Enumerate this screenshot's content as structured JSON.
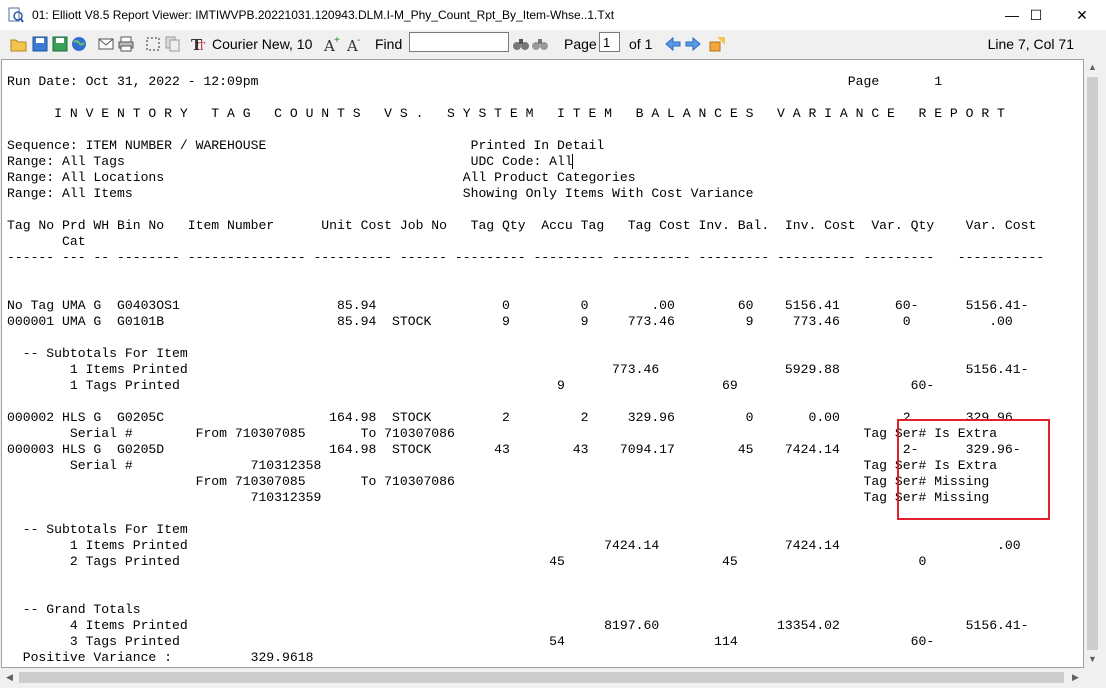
{
  "window": {
    "title": "01: Elliott V8.5 Report Viewer: IMTIWVPB.20221031.120943.DLM.I-M_Phy_Count_Rpt_By_Item-Whse..1.Txt",
    "minimize": "—",
    "maximize": "☐",
    "close": "✕"
  },
  "toolbar": {
    "font_label": "Courier New, 10",
    "find_label": "Find",
    "find_value": "",
    "page_label": "Page",
    "page_value": "1",
    "of_label": "of 1",
    "status": "Line 7, Col 71"
  },
  "icons": [
    "open-folder-icon",
    "save-icon",
    "save-as-icon",
    "globe-icon",
    "email-icon",
    "print-icon",
    "select-icon",
    "copy-icon",
    "font-icon",
    "zoom-in-icon",
    "zoom-out-icon",
    "binoculars-icon",
    "binoculars-next-icon",
    "back-arrow-icon",
    "forward-arrow-icon",
    "export-icon"
  ],
  "colors": {
    "highlight": "#e0202a"
  },
  "report": {
    "lines": [
      "Run Date: Oct 31, 2022 - 12:09pm                                                                           Page       1",
      "",
      "      I N V E N T O R Y   T A G   C O U N T S   V S .   S Y S T E M   I T E M   B A L A N C E S   V A R I A N C E   R E P O R T",
      "",
      "Sequence: ITEM NUMBER / WAREHOUSE                          Printed In Detail",
      "Range: All Tags                                            UDC Code: All",
      "Range: All Locations                                      All Product Categories",
      "Range: All Items                                          Showing Only Items With Cost Variance",
      "",
      "Tag No Prd WH Bin No   Item Number      Unit Cost Job No   Tag Qty  Accu Tag   Tag Cost Inv. Bal.  Inv. Cost  Var. Qty    Var. Cost",
      "       Cat",
      "------ --- -- -------- --------------- ---------- ------ --------- --------- ---------- --------- ---------- ---------   -----------",
      "",
      "",
      "No Tag UMA G  G0403OS1                    85.94                0         0        .00        60    5156.41       60-      5156.41-",
      "000001 UMA G  G0101B                      85.94  STOCK         9         9     773.46         9     773.46        0          .00",
      "",
      "  -- Subtotals For Item",
      "        1 Items Printed                                                      773.46                5929.88                5156.41-",
      "        1 Tags Printed                                                9                    69                      60-",
      "",
      "000002 HLS G  G0205C                     164.98  STOCK         2         2     329.96         0       0.00        2       329.96",
      "        Serial #        From 710307085       To 710307086                                                    Tag Ser# Is Extra",
      "000003 HLS G  G0205D                     164.98  STOCK        43        43    7094.17        45    7424.14        2-      329.96-",
      "        Serial #               710312358                                                                     Tag Ser# Is Extra",
      "                        From 710307085       To 710307086                                                    Tag Ser# Missing",
      "                               710312359                                                                     Tag Ser# Missing",
      "",
      "  -- Subtotals For Item",
      "        1 Items Printed                                                     7424.14                7424.14                    .00",
      "        2 Tags Printed                                               45                    45                       0",
      "",
      "",
      "  -- Grand Totals",
      "        4 Items Printed                                                     8197.60               13354.02                5156.41-",
      "        3 Tags Printed                                               54                   114                      60-",
      "  Positive Variance :          329.9618"
    ]
  }
}
